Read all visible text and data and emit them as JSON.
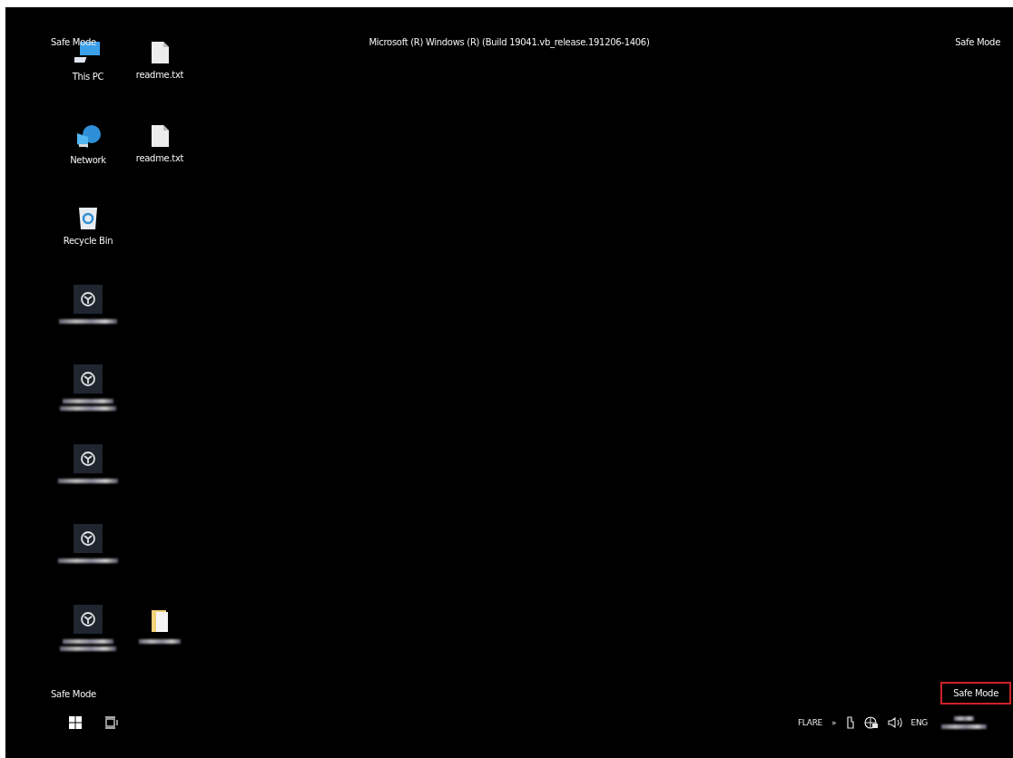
{
  "desktop": {
    "build_text": "Microsoft (R) Windows (R) (Build 19041.vb_release.191206-1406)",
    "corner_labels": [
      {
        "text": "Safe Mode",
        "highlighted": false
      },
      {
        "text": "Safe Mode",
        "highlighted": false
      },
      {
        "text": "Safe Mode",
        "highlighted": false
      },
      {
        "text": "Safe Mode",
        "highlighted": true
      }
    ],
    "icons": [
      {
        "kind": "pc",
        "label": "This PC"
      },
      {
        "kind": "text-file",
        "label": "readme.txt"
      },
      {
        "kind": "network",
        "label": "Network"
      },
      {
        "kind": "text-file",
        "label": "readme.txt"
      },
      {
        "kind": "recycle-bin",
        "label": "Recycle Bin"
      },
      {
        "kind": "app",
        "redacted": true
      },
      {
        "kind": "app",
        "redacted": true
      },
      {
        "kind": "app",
        "redacted": true
      },
      {
        "kind": "app",
        "redacted": true
      },
      {
        "kind": "app",
        "redacted": true
      },
      {
        "kind": "folder",
        "redacted": true
      }
    ]
  },
  "taskbar": {
    "tray_label": "FLARE",
    "overflow": "»",
    "language": "ENG",
    "clock": {
      "redacted": true
    }
  }
}
